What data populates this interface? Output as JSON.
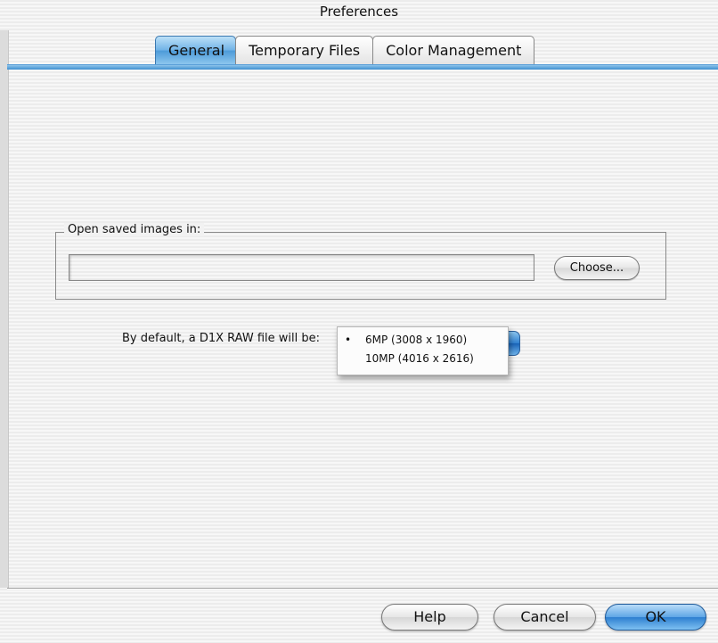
{
  "window": {
    "title": "Preferences"
  },
  "tabs": [
    {
      "label": "General",
      "active": true
    },
    {
      "label": "Temporary Files",
      "active": false
    },
    {
      "label": "Color Management",
      "active": false
    }
  ],
  "open_saved_group": {
    "label": "Open saved images in:",
    "path_value": "",
    "path_placeholder": "",
    "choose_label": "Choose..."
  },
  "default_raw": {
    "label": "By default, a D1X RAW file will be:",
    "options": [
      {
        "label": "6MP (3008 x 1960)",
        "selected": true,
        "marker": "•"
      },
      {
        "label": "10MP (4016 x 2616)",
        "selected": false,
        "marker": ""
      }
    ]
  },
  "footer": {
    "help_label": "Help",
    "cancel_label": "Cancel",
    "ok_label": "OK"
  },
  "colors": {
    "accent": "#4c9ad8",
    "default_button": "#2d7fd0"
  }
}
